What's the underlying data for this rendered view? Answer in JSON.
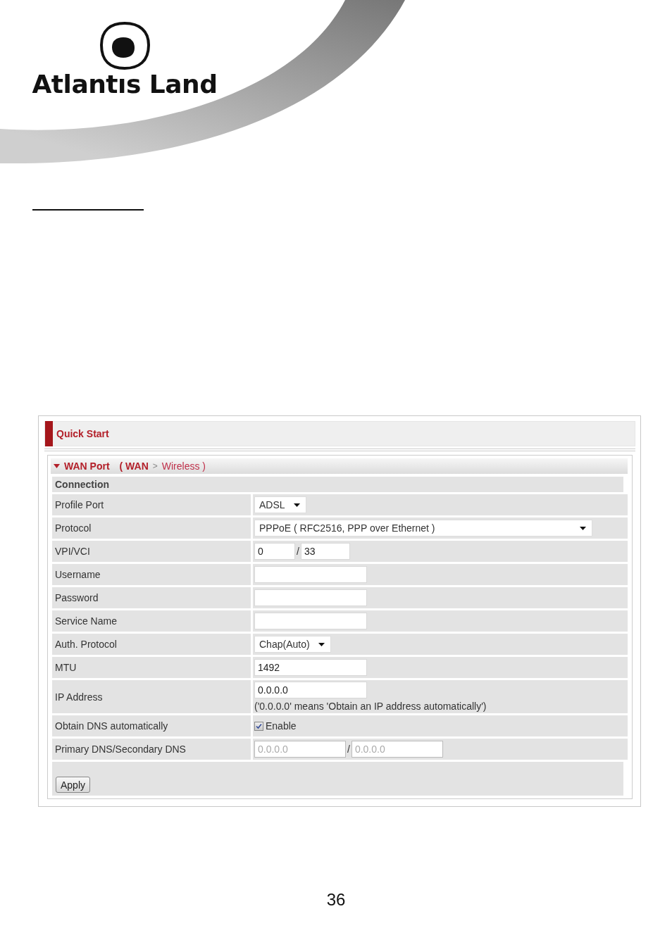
{
  "header": {
    "logo_text": "Atlantıs Land"
  },
  "panel": {
    "title": "Quick Start",
    "section": {
      "title": "WAN Port",
      "path": "( WAN",
      "separator": ">",
      "current": "Wireless )",
      "expanded": true
    },
    "group": "Connection",
    "rows": [
      {
        "kind": "select",
        "label": "Profile Port",
        "value": "ADSL"
      },
      {
        "kind": "wide-select",
        "label": "Protocol",
        "value": "PPPoE ( RFC2516, PPP over Ethernet )"
      },
      {
        "kind": "pair",
        "label": "VPI/VCI",
        "values": [
          "0",
          "33"
        ],
        "separator": "/",
        "disabled": false
      },
      {
        "kind": "input",
        "label": "Username"
      },
      {
        "kind": "input",
        "label": "Password"
      },
      {
        "kind": "input",
        "label": "Service Name"
      },
      {
        "kind": "select",
        "label": "Auth. Protocol",
        "value": "Chap(Auto)"
      },
      {
        "kind": "input",
        "label": "MTU",
        "value": "1492"
      },
      {
        "kind": "input",
        "label": "IP Address",
        "value": "0.0.0.0",
        "note": "('0.0.0.0' means 'Obtain an IP address automatically')"
      },
      {
        "kind": "checkbox",
        "label": "Obtain DNS automatically",
        "text": "Enable",
        "checked": true
      },
      {
        "kind": "pair",
        "label": "Primary DNS/Secondary DNS",
        "values": [
          "0.0.0.0",
          "0.0.0.0"
        ],
        "separator": "/",
        "disabled": true
      }
    ],
    "apply": "Apply"
  },
  "page_number": "36"
}
